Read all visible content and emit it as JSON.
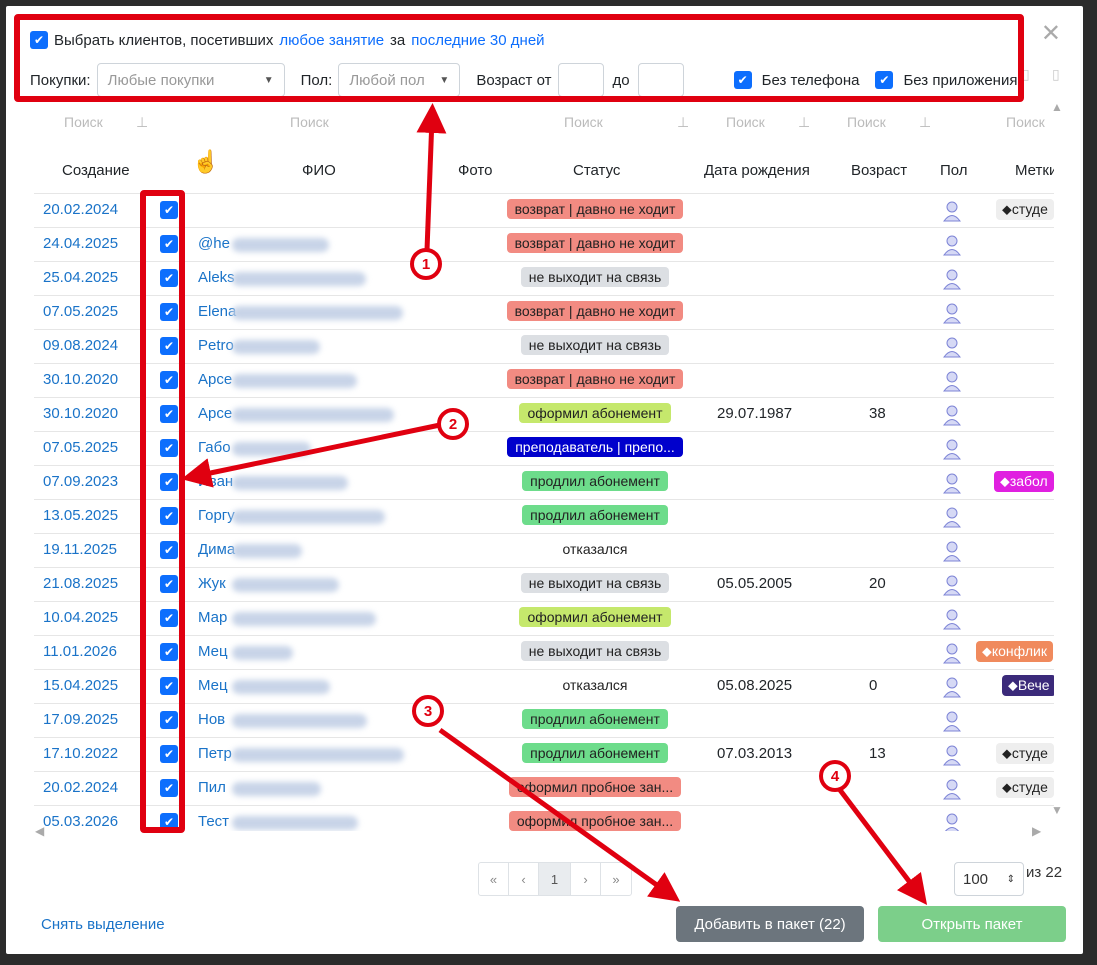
{
  "filter": {
    "select_label": "Выбрать клиентов, посетивших",
    "lesson_link": "любое занятие",
    "for": "за",
    "period_link": "последние 30 дней",
    "purchases_label": "Покупки:",
    "purchases_placeholder": "Любые покупки",
    "sex_label": "Пол:",
    "sex_placeholder": "Любой пол",
    "age_from_label": "Возраст от",
    "age_to_label": "до",
    "no_phone_label": "Без телефона",
    "no_app_label": "Без приложения"
  },
  "table": {
    "search_placeholder": "Поиск",
    "headers": {
      "created": "Создание",
      "name": "ФИО",
      "photo": "Фото",
      "status": "Статус",
      "birth": "Дата рождения",
      "age": "Возраст",
      "sex": "Пол",
      "tags": "Метки"
    },
    "rows": [
      {
        "date": "20.02.2024",
        "name": "",
        "status": "возврат | давно не ходит",
        "status_color": "#f28b82",
        "birth": "",
        "age": "",
        "tag": "студе",
        "tag_color": "#eeeeee"
      },
      {
        "date": "24.04.2025",
        "name": "@he",
        "status": "возврат | давно не ходит",
        "status_color": "#f28b82",
        "birth": "",
        "age": "",
        "tag": "",
        "tag_color": ""
      },
      {
        "date": "25.04.2025",
        "name": "Aleks",
        "status": "не выходит на связь",
        "status_color": "#dcdfe3",
        "birth": "",
        "age": "",
        "tag": "",
        "tag_color": ""
      },
      {
        "date": "07.05.2025",
        "name": "Elena",
        "status": "возврат | давно не ходит",
        "status_color": "#f28b82",
        "birth": "",
        "age": "",
        "tag": "",
        "tag_color": ""
      },
      {
        "date": "09.08.2024",
        "name": "Petro",
        "status": "не выходит на связь",
        "status_color": "#dcdfe3",
        "birth": "",
        "age": "",
        "tag": "",
        "tag_color": ""
      },
      {
        "date": "30.10.2020",
        "name": "Арсе",
        "status": "возврат | давно не ходит",
        "status_color": "#f28b82",
        "birth": "",
        "age": "",
        "tag": "",
        "tag_color": ""
      },
      {
        "date": "30.10.2020",
        "name": "Арсе",
        "status": "оформил абонемент",
        "status_color": "#c5e86c",
        "birth": "29.07.1987",
        "age": "38",
        "tag": "",
        "tag_color": ""
      },
      {
        "date": "07.05.2025",
        "name": "Габо",
        "status": "преподаватель | препо...",
        "status_color": "#0000cc",
        "birth": "",
        "age": "",
        "tag": "",
        "tag_color": ""
      },
      {
        "date": "07.09.2023",
        "name": "Иван",
        "status": "продлил абонемент",
        "status_color": "#6ddc8b",
        "birth": "",
        "age": "",
        "tag": "забол",
        "tag_color": "#e020e0"
      },
      {
        "date": "13.05.2025",
        "name": "Горгу",
        "status": "продлил абонемент",
        "status_color": "#6ddc8b",
        "birth": "",
        "age": "",
        "tag": "",
        "tag_color": ""
      },
      {
        "date": "19.11.2025",
        "name": "Дима",
        "status": "отказался",
        "status_color": "#ffffff",
        "birth": "",
        "age": "",
        "tag": "",
        "tag_color": ""
      },
      {
        "date": "21.08.2025",
        "name": "Жук",
        "status": "не выходит на связь",
        "status_color": "#dcdfe3",
        "birth": "05.05.2005",
        "age": "20",
        "tag": "",
        "tag_color": ""
      },
      {
        "date": "10.04.2025",
        "name": "Мар",
        "status": "оформил абонемент",
        "status_color": "#c5e86c",
        "birth": "",
        "age": "",
        "tag": "",
        "tag_color": ""
      },
      {
        "date": "11.01.2026",
        "name": "Мец",
        "status": "не выходит на связь",
        "status_color": "#dcdfe3",
        "birth": "",
        "age": "",
        "tag": "конфлик",
        "tag_color": "#f08a5d"
      },
      {
        "date": "15.04.2025",
        "name": "Мец",
        "status": "отказался",
        "status_color": "#ffffff",
        "birth": "05.08.2025",
        "age": "0",
        "tag": "Вече",
        "tag_color": "#3b2a7a"
      },
      {
        "date": "17.09.2025",
        "name": "Нов",
        "status": "продлил абонемент",
        "status_color": "#6ddc8b",
        "birth": "",
        "age": "",
        "tag": "",
        "tag_color": ""
      },
      {
        "date": "17.10.2022",
        "name": "Петр",
        "status": "продлил абонемент",
        "status_color": "#6ddc8b",
        "birth": "07.03.2013",
        "age": "13",
        "tag": "студе",
        "tag_color": "#eeeeee"
      },
      {
        "date": "20.02.2024",
        "name": "Пил",
        "status": "оформил пробное зан...",
        "status_color": "#f28b82",
        "birth": "",
        "age": "",
        "tag": "студе",
        "tag_color": "#eeeeee"
      },
      {
        "date": "05.03.2026",
        "name": "Тест",
        "status": "оформил пробное зан...",
        "status_color": "#f28b82",
        "birth": "",
        "age": "",
        "tag": "",
        "tag_color": ""
      }
    ]
  },
  "pagination": {
    "first": "«",
    "prev": "‹",
    "current": "1",
    "next": "›",
    "last": "»",
    "per_page": "100",
    "total": "из 22"
  },
  "actions": {
    "clear_selection": "Снять выделение",
    "add_to_package": "Добавить в пакет (22)",
    "open_package": "Открыть пакет"
  },
  "callouts": [
    "1",
    "2",
    "3",
    "4"
  ],
  "colors": {
    "accent": "#0d6efd",
    "annotation": "#e00010",
    "add_button": "#6c757d",
    "open_button": "#7ccf8a"
  }
}
